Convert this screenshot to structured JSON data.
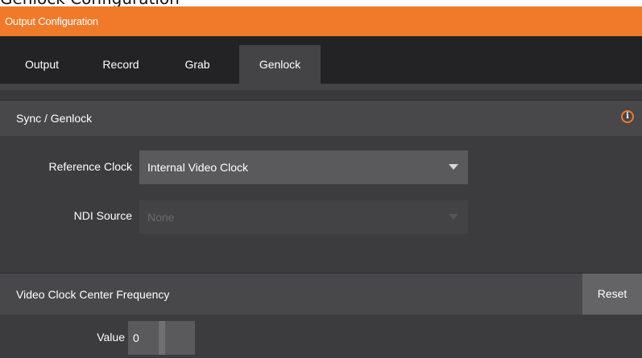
{
  "page_title_fragment": "Genlock Configuration",
  "window": {
    "title": "Output Configuration"
  },
  "tabs": [
    {
      "label": "Output",
      "active": false
    },
    {
      "label": "Record",
      "active": false
    },
    {
      "label": "Grab",
      "active": false
    },
    {
      "label": "Genlock",
      "active": true
    }
  ],
  "sync_section": {
    "title": "Sync / Genlock",
    "info_icon": "info-icon",
    "reference_clock": {
      "label": "Reference Clock",
      "value": "Internal Video Clock"
    },
    "ndi_source": {
      "label": "NDI Source",
      "value": "None",
      "disabled": true
    }
  },
  "frequency_section": {
    "title": "Video Clock Center Frequency",
    "reset_label": "Reset",
    "value_label": "Value",
    "value": "0"
  },
  "colors": {
    "accent": "#f07a2a",
    "panel": "#3c3c3e",
    "header": "#48484b",
    "tabbar": "#232325"
  }
}
